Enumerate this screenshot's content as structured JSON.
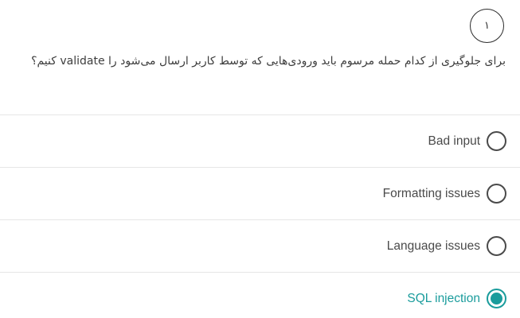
{
  "question": {
    "number": "۱",
    "text": "برای جلوگیری از کدام حمله مرسوم باید ورودی‌هایی که توسط کاربر ارسال می‌شود را validate کنیم؟"
  },
  "options": [
    {
      "label": "Bad input",
      "selected": false
    },
    {
      "label": "Formatting issues",
      "selected": false
    },
    {
      "label": "Language issues",
      "selected": false
    },
    {
      "label": "SQL injection",
      "selected": true
    }
  ],
  "colors": {
    "accent": "#1a9c9c",
    "text": "#424242",
    "divider": "#e6e6e6"
  }
}
